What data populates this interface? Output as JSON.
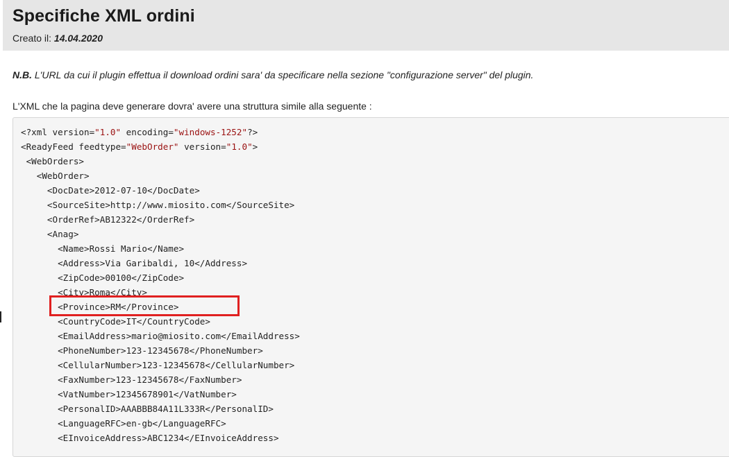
{
  "header": {
    "title": "Specifiche XML ordini",
    "created_label": "Creato il:",
    "created_date": "14.04.2020"
  },
  "note": {
    "prefix": "N.B.",
    "text": "L'URL da cui il plugin effettua il download ordini sara' da specificare nella sezione \"configurazione server\" del plugin."
  },
  "intro": "L'XML che la pagina deve generare dovra' avere una struttura simile alla seguente :",
  "code": {
    "line01": {
      "a": "<?xml version=",
      "b": "\"1.0\"",
      "c": " encoding=",
      "d": "\"windows-1252\"",
      "e": "?>"
    },
    "line02": {
      "a": "<ReadyFeed feedtype=",
      "b": "\"WebOrder\"",
      "c": " version=",
      "d": "\"1.0\"",
      "e": ">"
    },
    "line03": " <WebOrders>",
    "line04": "   <WebOrder>",
    "line05": "     <DocDate>2012-07-10</DocDate>",
    "line06": "     <SourceSite>http://www.miosito.com</SourceSite>",
    "line07": "     <OrderRef>AB12322</OrderRef>",
    "line08": "     <Anag>",
    "line09": "       <Name>Rossi Mario</Name>",
    "line10": "       <Address>Via Garibaldi, 10</Address>",
    "line11": "       <ZipCode>00100</ZipCode>",
    "line12": "       <City>Roma</City>",
    "line13": "       <Province>RM</Province>",
    "line14": "       <CountryCode>IT</CountryCode>",
    "line15": "       <EmailAddress>mario@miosito.com</EmailAddress>",
    "line16": "       <PhoneNumber>123-12345678</PhoneNumber>",
    "line17": "       <CellularNumber>123-12345678</CellularNumber>",
    "line18": "       <FaxNumber>123-12345678</FaxNumber>",
    "line19": "       <VatNumber>12345678901</VatNumber>",
    "line20": "       <PersonalID>AAABBB84A11L333R</PersonalID>",
    "line21": "       <LanguageRFC>en-gb</LanguageRFC>",
    "line22": "       <EInvoiceAddress>ABC1234</EInvoiceAddress>"
  },
  "colors": {
    "header_bg": "#e6e6e6",
    "code_bg": "#f5f5f5",
    "string_color": "#9a1111",
    "highlight": "#e02020"
  }
}
